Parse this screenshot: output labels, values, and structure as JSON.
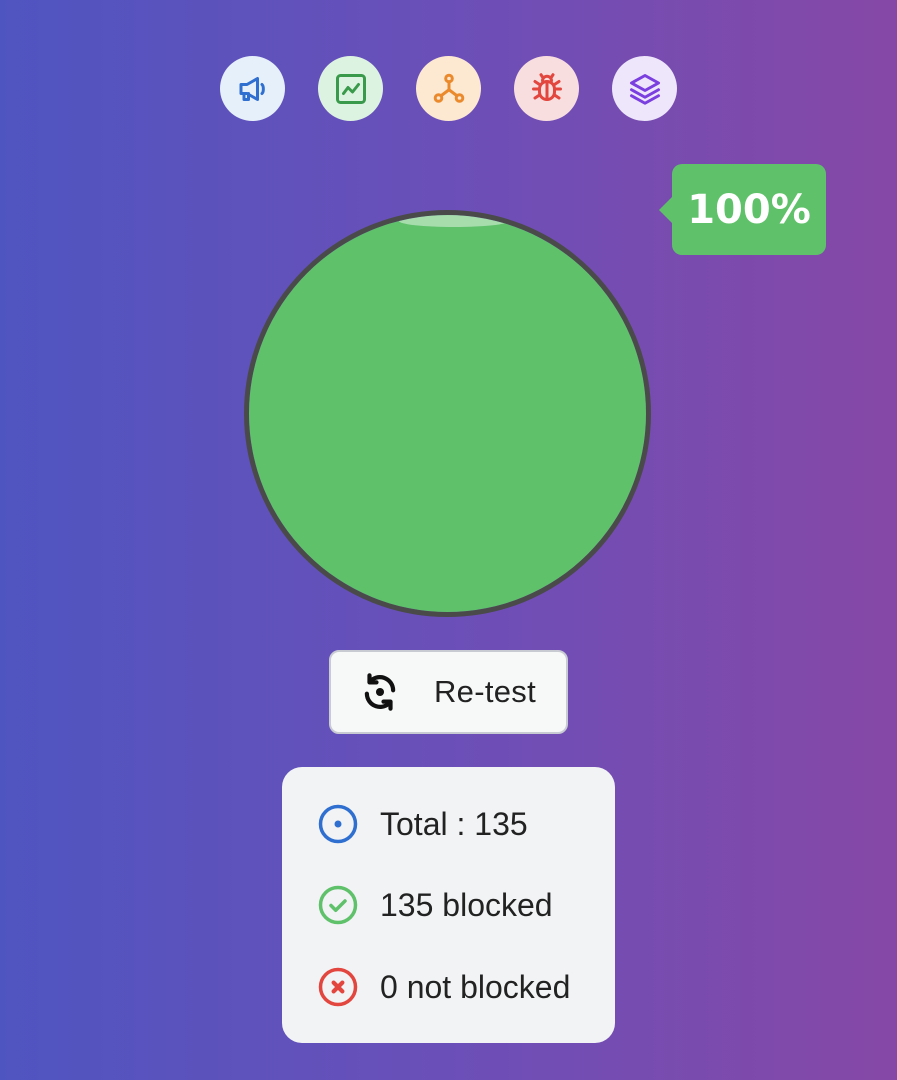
{
  "categories": [
    {
      "name": "ads",
      "icon": "megaphone-icon",
      "bg": "#e6f0fb",
      "color": "#2f6fd0"
    },
    {
      "name": "analytics",
      "icon": "chart-icon",
      "bg": "#ddf3e1",
      "color": "#3a9a4c"
    },
    {
      "name": "trackers",
      "icon": "network-icon",
      "bg": "#fde8d2",
      "color": "#ea8a2c"
    },
    {
      "name": "error-monitors",
      "icon": "bug-icon",
      "bg": "#f9dedf",
      "color": "#e2463e"
    },
    {
      "name": "mix",
      "icon": "layers-icon",
      "bg": "#eee6fb",
      "color": "#7b3fe0"
    }
  ],
  "gauge": {
    "percent": 100,
    "fill_color": "#5fc16a",
    "border_color": "#4a4a4a"
  },
  "badge": {
    "label": "100%",
    "color": "#5fc16a"
  },
  "retest": {
    "label": "Re-test",
    "icon": "refresh-icon"
  },
  "stats": {
    "total": "Total : 135",
    "blocked": "135 blocked",
    "not_blocked": "0 not blocked",
    "colors": {
      "total": "#2f6fd0",
      "blocked": "#5fc16a",
      "not_blocked": "#e2463e"
    }
  }
}
